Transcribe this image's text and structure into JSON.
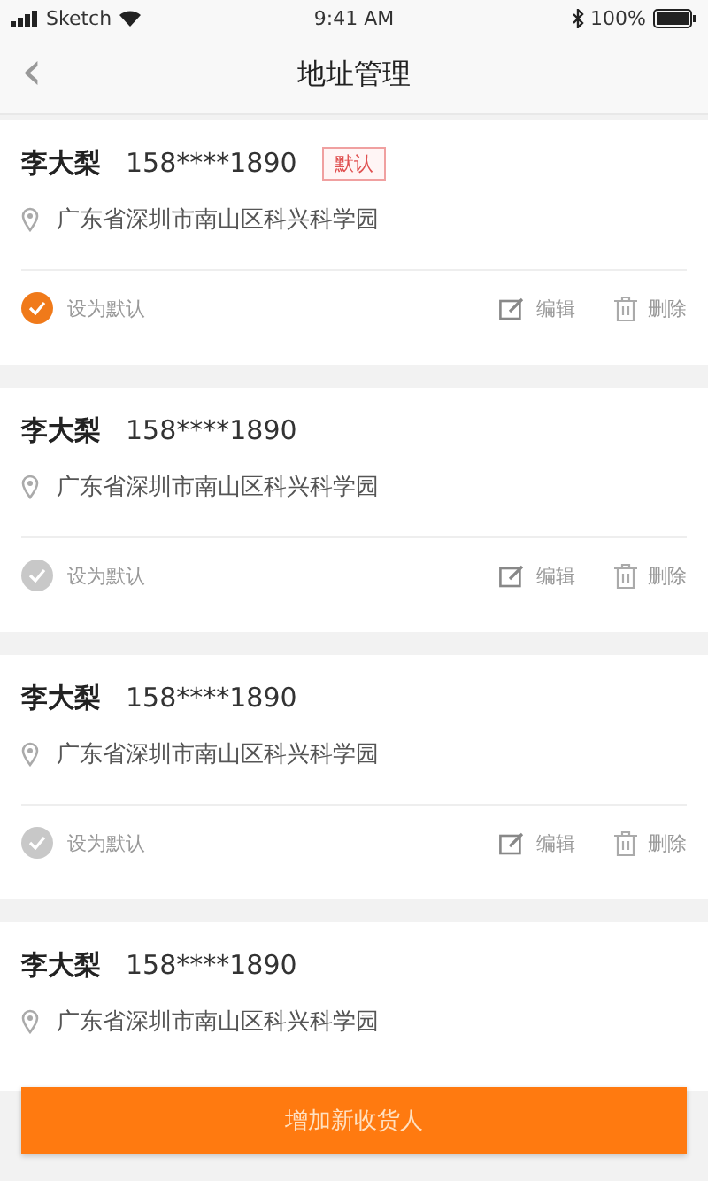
{
  "status_bar": {
    "carrier": "Sketch",
    "time": "9:41 AM",
    "battery": "100%"
  },
  "nav": {
    "back": "‹",
    "title": "地址管理"
  },
  "addresses": [
    {
      "name": "李大梨",
      "phone": "158****1890",
      "tag": "默认",
      "address": "广东省深圳市南山区科兴科学园",
      "actions": {
        "default_label": "设为默认",
        "selected": true,
        "edit": "编辑",
        "delete": "删除"
      }
    },
    {
      "name": "李大梨",
      "phone": "158****1890",
      "address": "广东省深圳市南山区科兴科学园",
      "actions": {
        "default_label": "设为默认",
        "selected": false,
        "edit": "编辑",
        "delete": "删除"
      }
    },
    {
      "name": "李大梨",
      "phone": "158****1890",
      "address": "广东省深圳市南山区科兴科学园",
      "actions": {
        "default_label": "设为默认",
        "selected": false,
        "edit": "编辑",
        "delete": "删除"
      }
    },
    {
      "name": "李大梨",
      "phone": "158****1890",
      "address": "广东省深圳市南山区科兴科学园"
    }
  ],
  "add_button": "增加新收货人"
}
